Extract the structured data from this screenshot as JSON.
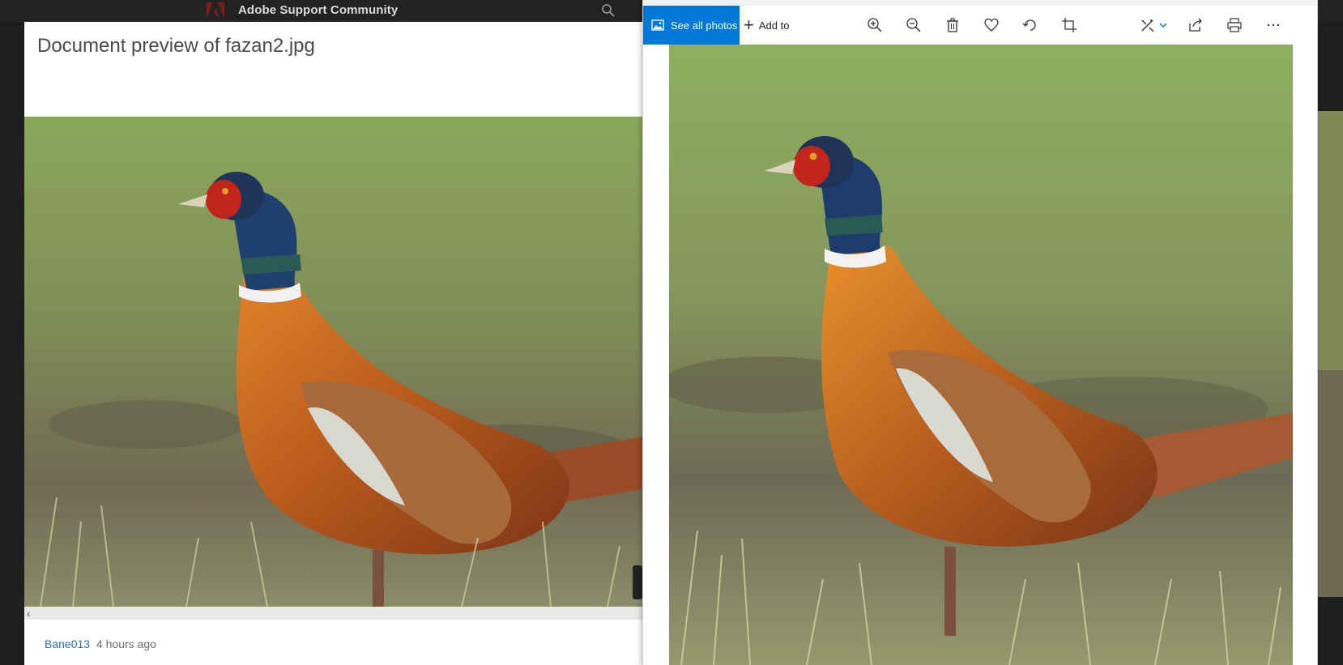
{
  "background_page": {
    "site_title": "Adobe Support Community",
    "logo": "adobe-logo",
    "search_icon": "search-icon"
  },
  "preview": {
    "title": "Document preview of fazan2.jpg",
    "image_alt": "pheasant-photo",
    "author": "Bane013",
    "time": "4 hours ago",
    "scroll_left_icon": "chevron-left-icon"
  },
  "photos_app": {
    "see_all_label": "See all photos",
    "add_to_label": "Add to",
    "accent": "#0078d7",
    "toolbar_icons": [
      "zoom-in-icon",
      "zoom-out-icon",
      "delete-icon",
      "favorite-icon",
      "rotate-icon",
      "crop-icon",
      "edit-icon",
      "share-icon",
      "print-icon",
      "more-icon"
    ],
    "image_alt": "pheasant-photo"
  }
}
